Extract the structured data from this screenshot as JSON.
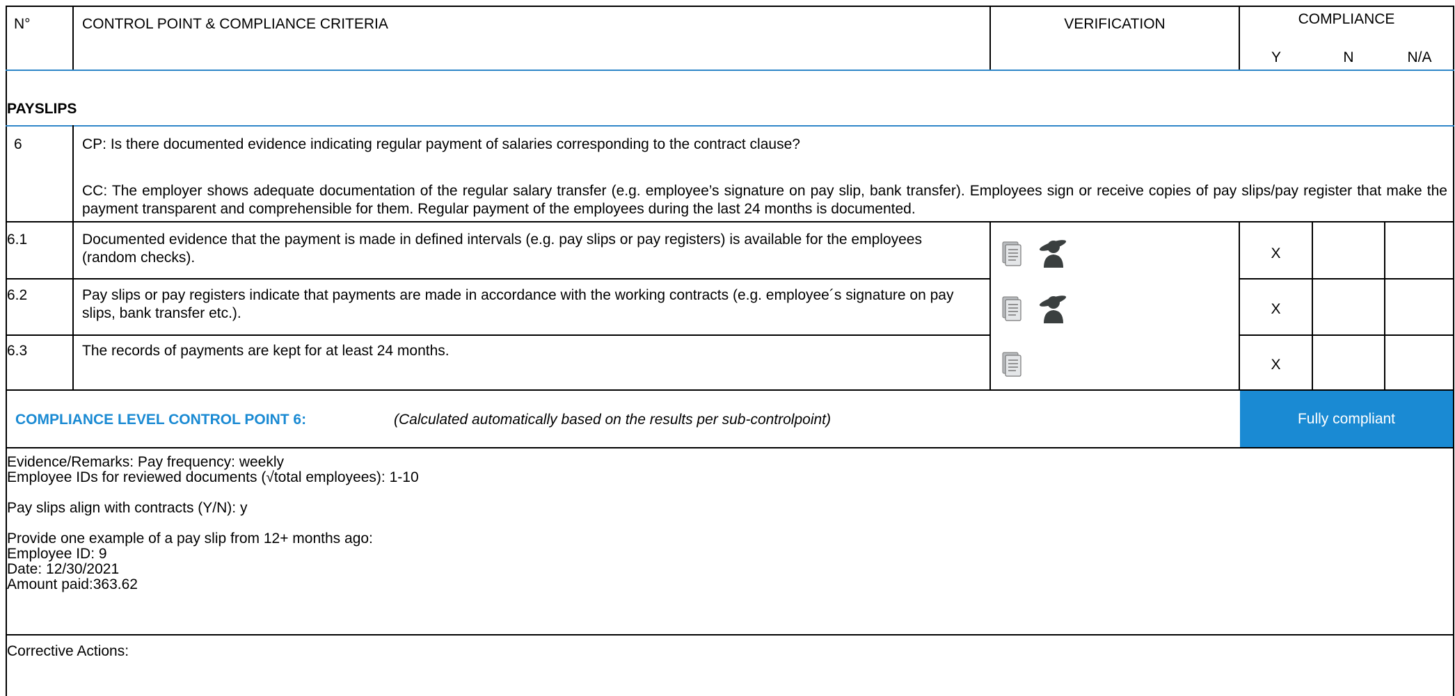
{
  "header": {
    "col_no": "N°",
    "col_criteria": "CONTROL POINT & COMPLIANCE CRITERIA",
    "col_verification": "VERIFICATION",
    "col_compliance": "COMPLIANCE",
    "col_y": "Y",
    "col_n": "N",
    "col_na": "N/A"
  },
  "section": {
    "title": "PAYSLIPS"
  },
  "control_point": {
    "number": "6",
    "cp": "CP: Is there documented evidence indicating regular payment of salaries corresponding to the contract clause?",
    "cc": "CC: The employer shows adequate documentation of the regular salary transfer (e.g. employee’s signature on pay slip, bank transfer). Employees sign or receive copies of pay slips/pay register that make the payment transparent and comprehensible for them. Regular payment of the employees during the last 24 months is documented."
  },
  "sub_points": [
    {
      "number": "6.1",
      "text": "Documented evidence that the payment is made in defined intervals (e.g. pay slips or pay registers) is available for the employees (random checks).",
      "icons": [
        "document-icon",
        "interview-person-icon"
      ],
      "y": "X",
      "n": "",
      "na": ""
    },
    {
      "number": "6.2",
      "text": "Pay slips or pay registers indicate that payments are made in accordance with the working contracts (e.g. employee´s signature on pay slips, bank transfer etc.).",
      "icons": [
        "document-icon",
        "interview-person-icon"
      ],
      "y": "X",
      "n": "",
      "na": ""
    },
    {
      "number": "6.3",
      "text": "The records of payments are kept for at least 24 months.",
      "icons": [
        "document-icon"
      ],
      "y": "X",
      "n": "",
      "na": ""
    }
  ],
  "compliance_level": {
    "label": "COMPLIANCE LEVEL CONTROL POINT 6:",
    "note": "(Calculated automatically based on the results per sub-controlpoint)",
    "result": "Fully compliant",
    "result_color": "#1a8ad3",
    "label_color": "#1a8ad3"
  },
  "evidence": {
    "lines": [
      "Evidence/Remarks: Pay frequency: weekly",
      "Employee IDs for reviewed documents (√total employees): 1-10",
      "",
      "Pay slips align with contracts (Y/N): y",
      "",
      "Provide one example of a pay slip from 12+ months ago:",
      "Employee ID: 9",
      "Date: 12/30/2021",
      "Amount paid:363.62"
    ]
  },
  "corrective": {
    "label": "Corrective Actions:"
  }
}
